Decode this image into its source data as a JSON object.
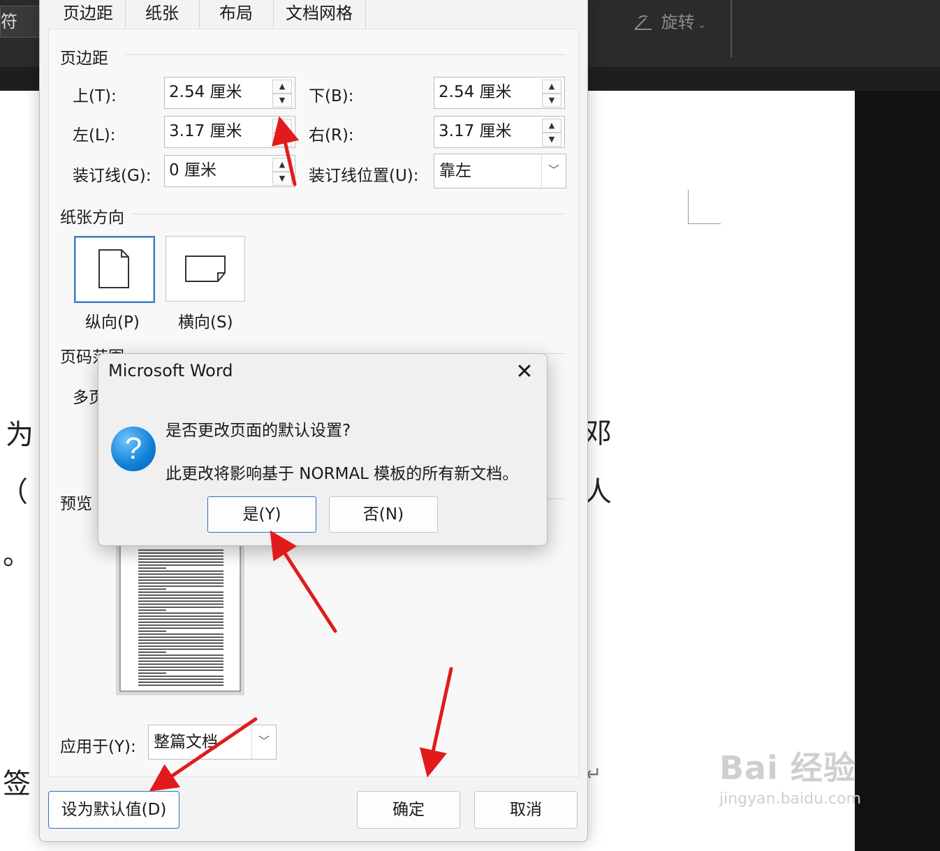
{
  "background": {
    "left_tab_label": "符",
    "rotate_label": "旋转",
    "document_chars": [
      "为",
      "（",
      "。",
      "签"
    ],
    "document_chars_right": [
      "邓",
      "人"
    ],
    "return_mark": "↵"
  },
  "watermark": {
    "logo": "Bai 经验",
    "url": "jingyan.baidu.com"
  },
  "page_setup": {
    "tabs": [
      "页边距",
      "纸张",
      "布局",
      "文档网格"
    ],
    "margins_title": "页边距",
    "top_label": "上(T):",
    "top_value": "2.54 厘米",
    "bottom_label": "下(B):",
    "bottom_value": "2.54 厘米",
    "left_label": "左(L):",
    "left_value": "3.17 厘米",
    "right_label": "右(R):",
    "right_value": "3.17 厘米",
    "gutter_label": "装订线(G):",
    "gutter_value": "0 厘米",
    "gutter_pos_label": "装订线位置(U):",
    "gutter_pos_value": "靠左",
    "orientation_title": "纸张方向",
    "portrait_label": "纵向(P)",
    "landscape_label": "横向(S)",
    "pages_title": "页码范围",
    "multiple_pages_label": "多页",
    "preview_title": "预览",
    "apply_label": "应用于(Y):",
    "apply_value": "整篇文档",
    "set_default_button": "设为默认值(D)",
    "ok_button": "确定",
    "cancel_button": "取消"
  },
  "message_box": {
    "title": "Microsoft Word",
    "question": "是否更改页面的默认设置?",
    "detail": "此更改将影响基于 NORMAL 模板的所有新文档。",
    "yes_button": "是(Y)",
    "no_button": "否(N)",
    "close_symbol": "✕"
  },
  "colors": {
    "accent": "#2f6fbf",
    "annotation_arrow": "#e11b1b",
    "dark_ui": "#2b2b2b"
  }
}
